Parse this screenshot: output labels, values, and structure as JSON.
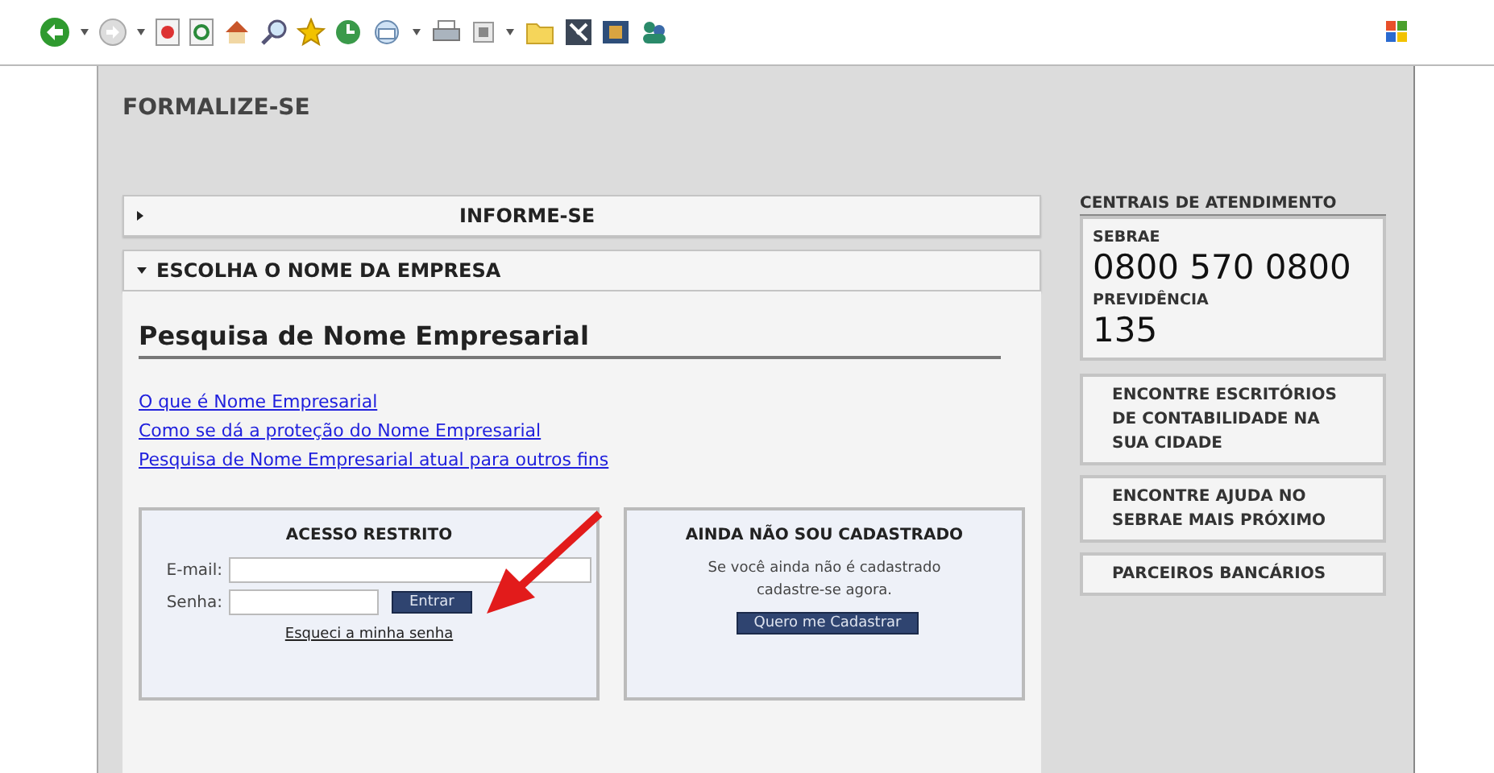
{
  "page": {
    "title": "FORMALIZE-SE",
    "sections": [
      {
        "title": "INFORME-SE",
        "expanded": false
      },
      {
        "title": "ESCOLHA O NOME DA EMPRESA",
        "expanded": true
      }
    ],
    "heading": "Pesquisa de Nome Empresarial",
    "links": [
      "O que é Nome Empresarial",
      "Como se dá a proteção do Nome Empresarial",
      "Pesquisa de Nome Empresarial atual para outros fins"
    ],
    "login": {
      "title": "ACESSO RESTRITO",
      "email_label": "E-mail:",
      "password_label": "Senha:",
      "button": "Entrar",
      "forgot": "Esqueci a minha senha"
    },
    "signup": {
      "title": "AINDA NÃO SOU CADASTRADO",
      "text": "Se você ainda não é cadastrado cadastre-se agora.",
      "button": "Quero me Cadastrar"
    },
    "contact": {
      "title": "CENTRAIS DE ATENDIMENTO",
      "lines": [
        {
          "label": "SEBRAE",
          "number": "0800 570 0800"
        },
        {
          "label": "PREVIDÊNCIA",
          "number": "135"
        }
      ]
    },
    "side_buttons": [
      "ENCONTRE ESCRITÓRIOS DE CONTABILIDADE NA SUA CIDADE",
      "ENCONTRE AJUDA NO SEBRAE MAIS PRÓXIMO",
      "PARCEIROS BANCÁRIOS"
    ]
  }
}
